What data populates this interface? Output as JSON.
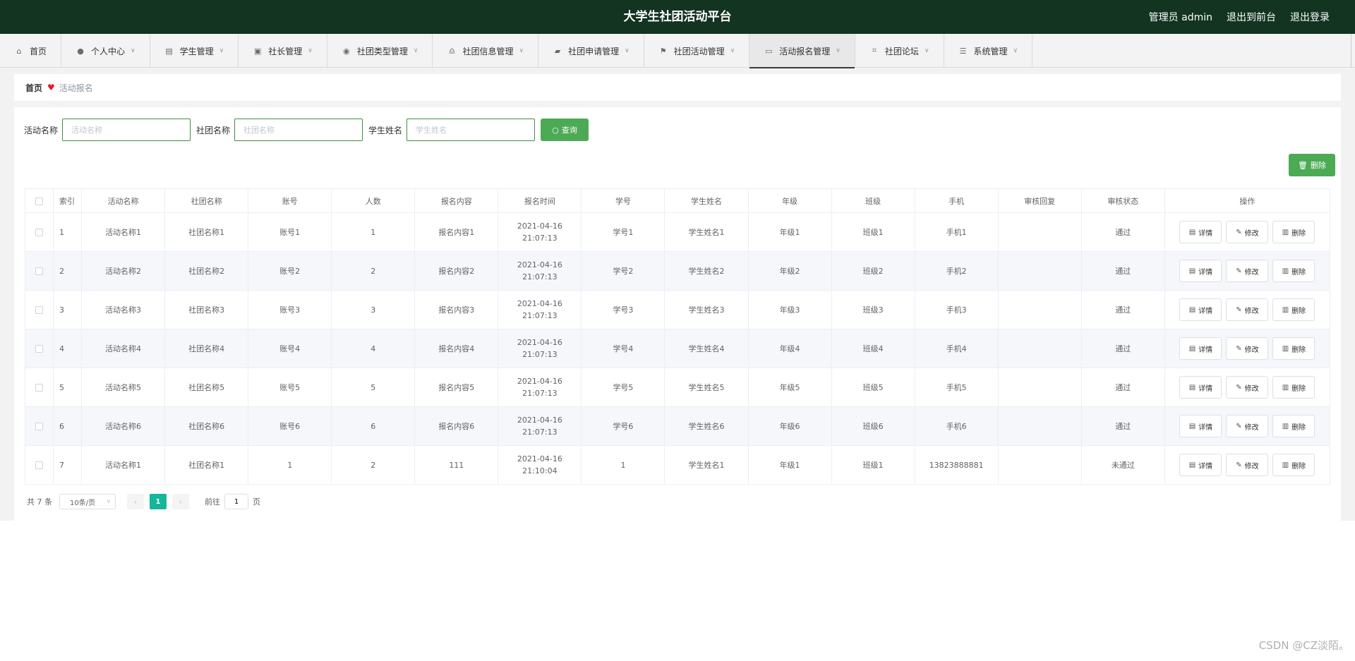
{
  "header": {
    "title": "大学生社团活动平台",
    "admin_label": "管理员 admin",
    "front_label": "退出到前台",
    "logout_label": "退出登录"
  },
  "menu": [
    {
      "label": "首页",
      "icon": "home-icon",
      "has_dropdown": false
    },
    {
      "label": "个人中心",
      "icon": "user-icon",
      "has_dropdown": true
    },
    {
      "label": "学生管理",
      "icon": "printer-icon",
      "has_dropdown": true
    },
    {
      "label": "社长管理",
      "icon": "image-icon",
      "has_dropdown": true
    },
    {
      "label": "社团类型管理",
      "icon": "location-icon",
      "has_dropdown": true
    },
    {
      "label": "社团信息管理",
      "icon": "bell-icon",
      "has_dropdown": true
    },
    {
      "label": "社团申请管理",
      "icon": "coffee-icon",
      "has_dropdown": true
    },
    {
      "label": "社团活动管理",
      "icon": "flag-icon",
      "has_dropdown": true
    },
    {
      "label": "活动报名管理",
      "icon": "card-icon",
      "has_dropdown": true,
      "active": true
    },
    {
      "label": "社团论坛",
      "icon": "crop-icon",
      "has_dropdown": true
    },
    {
      "label": "系统管理",
      "icon": "list-icon",
      "has_dropdown": true
    }
  ],
  "breadcrumb": {
    "home": "首页",
    "current": "活动报名"
  },
  "search": {
    "activity_label": "活动名称",
    "activity_placeholder": "活动名称",
    "club_label": "社团名称",
    "club_placeholder": "社团名称",
    "student_label": "学生姓名",
    "student_placeholder": "学生姓名",
    "query_label": "查询"
  },
  "delete_label": "删除",
  "table": {
    "columns": [
      "索引",
      "活动名称",
      "社团名称",
      "账号",
      "人数",
      "报名内容",
      "报名时间",
      "学号",
      "学生姓名",
      "年级",
      "班级",
      "手机",
      "审核回复",
      "审核状态",
      "操作"
    ],
    "rows": [
      [
        "1",
        "活动名称1",
        "社团名称1",
        "账号1",
        "1",
        "报名内容1",
        "2021-04-16 21:07:13",
        "学号1",
        "学生姓名1",
        "年级1",
        "班级1",
        "手机1",
        "",
        "通过"
      ],
      [
        "2",
        "活动名称2",
        "社团名称2",
        "账号2",
        "2",
        "报名内容2",
        "2021-04-16 21:07:13",
        "学号2",
        "学生姓名2",
        "年级2",
        "班级2",
        "手机2",
        "",
        "通过"
      ],
      [
        "3",
        "活动名称3",
        "社团名称3",
        "账号3",
        "3",
        "报名内容3",
        "2021-04-16 21:07:13",
        "学号3",
        "学生姓名3",
        "年级3",
        "班级3",
        "手机3",
        "",
        "通过"
      ],
      [
        "4",
        "活动名称4",
        "社团名称4",
        "账号4",
        "4",
        "报名内容4",
        "2021-04-16 21:07:13",
        "学号4",
        "学生姓名4",
        "年级4",
        "班级4",
        "手机4",
        "",
        "通过"
      ],
      [
        "5",
        "活动名称5",
        "社团名称5",
        "账号5",
        "5",
        "报名内容5",
        "2021-04-16 21:07:13",
        "学号5",
        "学生姓名5",
        "年级5",
        "班级5",
        "手机5",
        "",
        "通过"
      ],
      [
        "6",
        "活动名称6",
        "社团名称6",
        "账号6",
        "6",
        "报名内容6",
        "2021-04-16 21:07:13",
        "学号6",
        "学生姓名6",
        "年级6",
        "班级6",
        "手机6",
        "",
        "通过"
      ],
      [
        "7",
        "活动名称1",
        "社团名称1",
        "1",
        "2",
        "111",
        "2021-04-16 21:10:04",
        "1",
        "学生姓名1",
        "年级1",
        "班级1",
        "13823888881",
        "",
        "未通过"
      ]
    ],
    "actions": {
      "detail": "详情",
      "edit": "修改",
      "delete": "删除"
    }
  },
  "pagination": {
    "total": "共 7 条",
    "page_size": "10条/页",
    "current_page": "1",
    "goto_label": "前往",
    "goto_value": "1",
    "page_suffix": "页"
  },
  "watermark": "CSDN @CZ淡陌。",
  "colors": {
    "header_bg": "#123421",
    "primary_green": "#4caa55",
    "pager_active": "#13b79a",
    "heart": "#e0202a"
  }
}
